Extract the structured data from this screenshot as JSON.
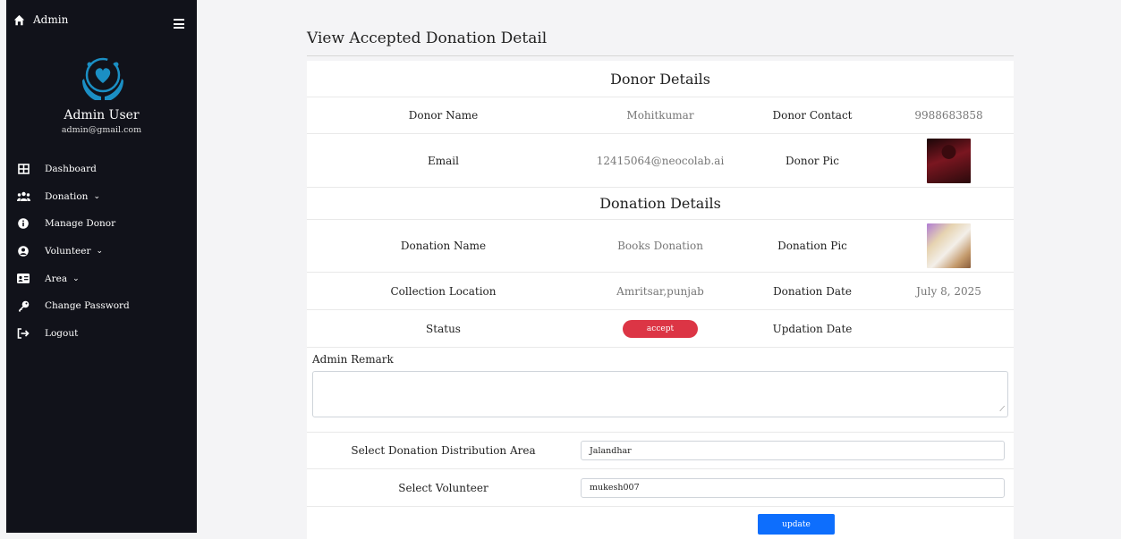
{
  "sidebar": {
    "brand": "Admin",
    "user_name": "Admin User",
    "user_email": "admin@gmail.com",
    "items": [
      {
        "label": "Dashboard",
        "icon": "dashboard-icon"
      },
      {
        "label": "Donation",
        "icon": "users-icon",
        "has_chevron": true
      },
      {
        "label": "Manage Donor",
        "icon": "info-icon"
      },
      {
        "label": "Volunteer",
        "icon": "user-circle-icon",
        "has_chevron": true
      },
      {
        "label": "Area",
        "icon": "id-card-icon",
        "has_chevron": true
      },
      {
        "label": "Change Password",
        "icon": "key-icon"
      },
      {
        "label": "Logout",
        "icon": "logout-icon"
      }
    ],
    "chevron": "⌄"
  },
  "page": {
    "title": "View Accepted Donation Detail"
  },
  "donor": {
    "section_title": "Donor Details",
    "name_label": "Donor Name",
    "name_value": "Mohitkumar",
    "contact_label": "Donor Contact",
    "contact_value": "9988683858",
    "email_label": "Email",
    "email_value": "12415064@neocolab.ai",
    "pic_label": "Donor Pic"
  },
  "donation": {
    "section_title": "Donation Details",
    "name_label": "Donation Name",
    "name_value": "Books Donation",
    "pic_label": "Donation Pic",
    "location_label": "Collection Location",
    "location_value": "Amritsar,punjab",
    "date_label": "Donation Date",
    "date_value": "July 8, 2025",
    "status_label": "Status",
    "status_value": "accept",
    "updation_label": "Updation Date",
    "updation_value": ""
  },
  "form": {
    "remark_label": "Admin Remark",
    "remark_value": "",
    "area_label": "Select Donation Distribution Area",
    "area_value": "Jalandhar",
    "volunteer_label": "Select Volunteer",
    "volunteer_value": "mukesh007",
    "update_label": "update"
  },
  "colors": {
    "sidebar_bg": "#11121a",
    "accent": "#0d6efd",
    "status_badge": "#dc3545",
    "logo": "#1b8fc4"
  }
}
